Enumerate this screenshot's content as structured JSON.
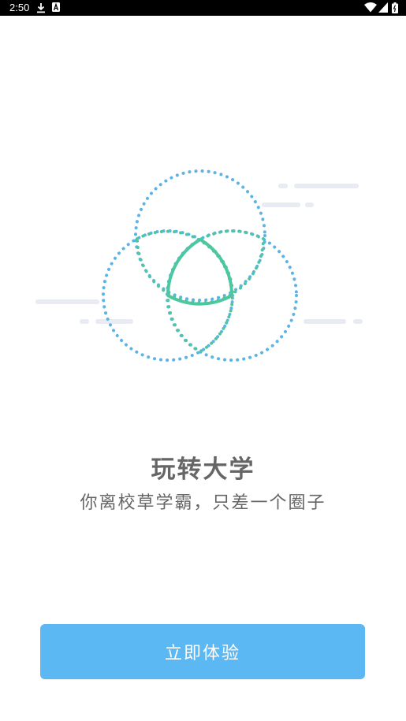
{
  "status_bar": {
    "time": "2:50",
    "icons": [
      "download-icon",
      "text-a-icon",
      "wifi-icon",
      "signal-icon",
      "battery-icon"
    ]
  },
  "welcome": {
    "title": "玩转大学",
    "subtitle": "你离校草学霸，只差一个圈子",
    "cta_label": "立即体验"
  },
  "colors": {
    "circle_blue": "#5cb3e6",
    "circle_green": "#4cc79f",
    "streak_gray": "#e8ebf2",
    "button_bg": "#5bb8f2",
    "text_gray": "#666666"
  }
}
